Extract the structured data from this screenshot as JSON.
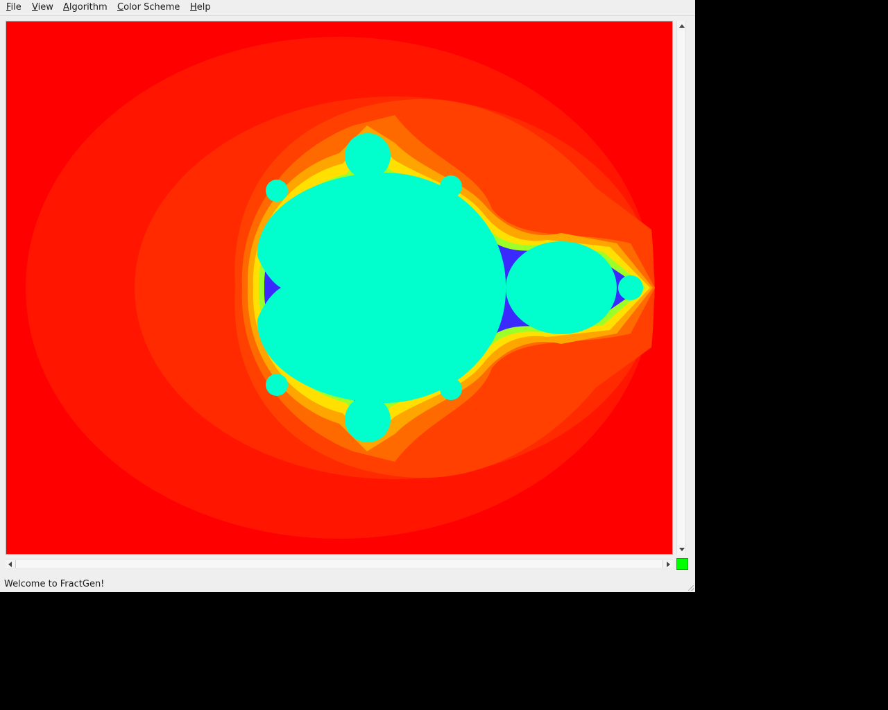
{
  "menubar": {
    "items": [
      {
        "label": "File",
        "mnemonic": "F",
        "rest": "ile"
      },
      {
        "label": "View",
        "mnemonic": "V",
        "rest": "iew"
      },
      {
        "label": "Algorithm",
        "mnemonic": "A",
        "rest": "lgorithm"
      },
      {
        "label": "Color Scheme",
        "mnemonic": "C",
        "rest": "olor Scheme"
      },
      {
        "label": "Help",
        "mnemonic": "H",
        "rest": "elp"
      }
    ]
  },
  "canvas": {
    "content": "mandelbrot-set",
    "colors": {
      "background": "#ff0000",
      "band_1": "#ff1500",
      "band_2": "#ff2a00",
      "band_3": "#ff4000",
      "band_4": "#ff6a00",
      "band_5": "#ffa500",
      "band_6": "#ffe000",
      "band_7": "#9cff2a",
      "edge": "#3a2aff",
      "interior": "#00ffcc"
    }
  },
  "status_indicator": {
    "color": "#00ff00"
  },
  "statusbar": {
    "message": "Welcome to FractGen!"
  }
}
